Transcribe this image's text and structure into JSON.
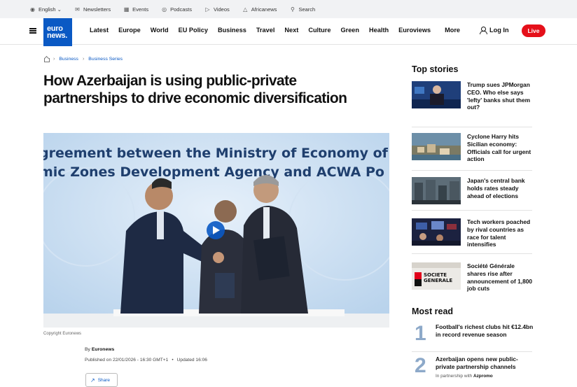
{
  "utility_bar": {
    "items": [
      {
        "icon": "globe-icon",
        "label": "English ⌄"
      },
      {
        "icon": "mail-icon",
        "label": "Newsletters"
      },
      {
        "icon": "calendar-icon",
        "label": "Events"
      },
      {
        "icon": "mic-icon",
        "label": "Podcasts"
      },
      {
        "icon": "play-icon",
        "label": "Videos"
      },
      {
        "icon": "africanews-icon",
        "label": "Africanews"
      },
      {
        "icon": "search-icon",
        "label": "Search"
      }
    ]
  },
  "navbar": {
    "logo_line1": "euro",
    "logo_line2": "news.",
    "links": [
      "Latest",
      "Europe",
      "World",
      "EU Policy",
      "Business",
      "Travel",
      "Next",
      "Culture",
      "Green",
      "Health",
      "Euroviews",
      "More"
    ],
    "login_label": "Log In",
    "live_label": "Live"
  },
  "article": {
    "breadcrumb": [
      "Business",
      "Business Series"
    ],
    "headline": "How Azerbaijan is using public-private partnerships to drive economic diversification",
    "hero_banner_line1": "greement between the Ministry of Economy of",
    "hero_banner_line2": "mic Zones Development Agency and ACWA Po",
    "caption": "Copyright Euronews",
    "byline_prefix": "By",
    "byline_author": "Euronews",
    "published": "Published on 22/01/2026 - 16:30 GMT+1",
    "bullet": "•",
    "updated": "Updated 16:06",
    "share_label": "Share"
  },
  "sidebar": {
    "top_stories_title": "Top stories",
    "stories": [
      {
        "title": "Trump sues JPMorgan CEO. Who else says 'lefty' banks shut them out?"
      },
      {
        "title": "Cyclone Harry hits Sicilian economy: Officials call for urgent action"
      },
      {
        "title": "Japan's central bank holds rates steady ahead of elections"
      },
      {
        "title": "Tech workers poached by rival countries as race for talent intensifies"
      },
      {
        "title": "Société Générale shares rise after announcement of 1,800 job cuts"
      }
    ],
    "sg_sign_line1": "SOCIETE",
    "sg_sign_line2": "GENERALE",
    "most_read_title": "Most read",
    "most_read": [
      {
        "rank": "1",
        "title": "Football's richest clubs hit €12.4bn in record revenue season"
      },
      {
        "rank": "2",
        "title": "Azerbaijan opens new public-private partnership channels",
        "sponsor_prefix": "In partnership with",
        "sponsor": "Azpromo"
      }
    ]
  }
}
